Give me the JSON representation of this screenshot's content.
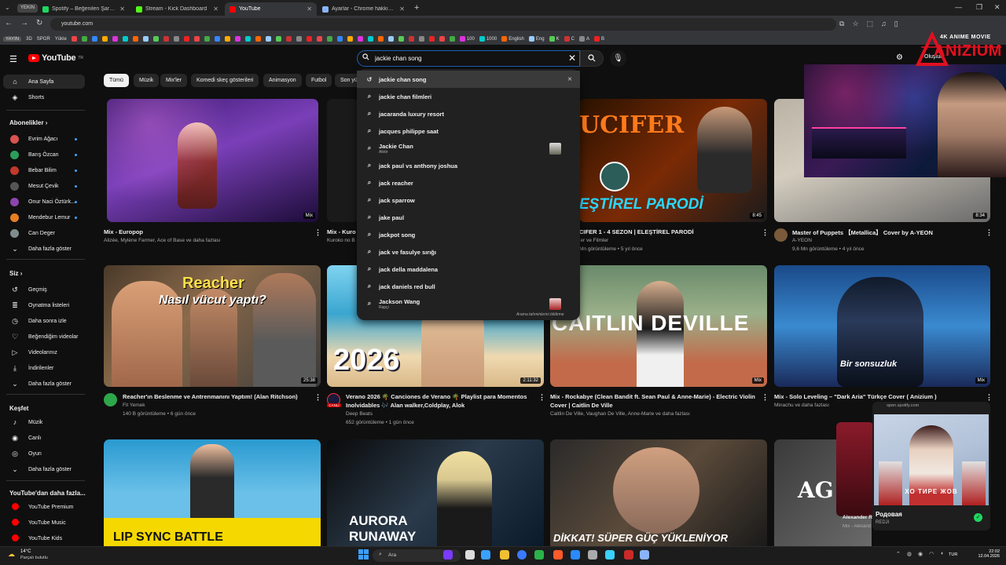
{
  "browser": {
    "profile_badge": "YEKIN",
    "tabs": [
      {
        "title": "Spotify – Beğenilen Şarkılar",
        "favicon_color": "#1ed760",
        "active": false
      },
      {
        "title": "Stream - Kick Dashboard",
        "favicon_color": "#53fc18",
        "active": false
      },
      {
        "title": "YouTube",
        "favicon_color": "#ff0000",
        "active": true
      },
      {
        "title": "Ayarlar - Chrome hakkında",
        "favicon_color": "#8ab4f8",
        "active": false
      }
    ],
    "url": "youtube.com",
    "bookmarks": [
      {
        "label": "YAYIN",
        "boxed": true
      },
      {
        "label": "3D",
        "boxed": false
      },
      {
        "label": "SPOR",
        "boxed": false
      },
      {
        "label": "Yükle",
        "boxed": false
      },
      {
        "label": "100",
        "boxed": false
      },
      {
        "label": "1000",
        "boxed": false
      },
      {
        "label": "English",
        "boxed": false
      },
      {
        "label": "Eng",
        "boxed": false
      },
      {
        "label": "K",
        "boxed": false
      },
      {
        "label": "C",
        "boxed": false
      },
      {
        "label": "A",
        "boxed": false
      },
      {
        "label": "B",
        "boxed": false
      }
    ]
  },
  "brand_overlay": {
    "small": "4K ANIME MOVIE",
    "big": "ANIZIUM"
  },
  "header": {
    "logo_text": "YouTube",
    "logo_region": "TR",
    "search_value": "jackie chan song",
    "create_label": "Oluştur"
  },
  "chips": [
    "Tümü",
    "Müzik",
    "Mix'ler",
    "Komedi skeç gösterileri",
    "Animasyon",
    "Futbol",
    "Son yü"
  ],
  "sidebar": {
    "main": [
      {
        "label": "Ana Sayfa",
        "icon": "home-icon",
        "glyph": "⌂"
      },
      {
        "label": "Shorts",
        "icon": "shorts-icon",
        "glyph": "◈"
      }
    ],
    "subs_title": "Abonelikler",
    "subscriptions": [
      {
        "label": "Evrim Ağacı",
        "color": "#d9534f"
      },
      {
        "label": "Barış Özcan",
        "color": "#2a9d5c"
      },
      {
        "label": "Bebar Bilim",
        "color": "#c0392b"
      },
      {
        "label": "Mesut Çevik",
        "color": "#555555"
      },
      {
        "label": "Onur Naci Öztürk...",
        "color": "#8e44ad"
      },
      {
        "label": "Mendebur Lemur",
        "color": "#e67e22"
      },
      {
        "label": "Can Deger",
        "color": "#7f8c8d"
      }
    ],
    "subs_more": "Daha fazla göster",
    "you_title": "Siz",
    "you": [
      {
        "label": "Geçmiş",
        "icon": "history-icon",
        "glyph": "↺"
      },
      {
        "label": "Oynatma listeleri",
        "icon": "playlists-icon",
        "glyph": "≣"
      },
      {
        "label": "Daha sonra izle",
        "icon": "watch-later-icon",
        "glyph": "◷"
      },
      {
        "label": "Beğendiğim videolar",
        "icon": "like-icon",
        "glyph": "♡"
      },
      {
        "label": "Videolarınız",
        "icon": "your-videos-icon",
        "glyph": "▷"
      },
      {
        "label": "İndirilenler",
        "icon": "download-icon",
        "glyph": "⤓"
      },
      {
        "label": "Daha fazla göster",
        "icon": "chevron-down-icon",
        "glyph": "⌄"
      }
    ],
    "explore_title": "Keşfet",
    "explore": [
      {
        "label": "Müzik",
        "icon": "music-icon",
        "glyph": "♪"
      },
      {
        "label": "Canlı",
        "icon": "live-icon",
        "glyph": "◉"
      },
      {
        "label": "Oyun",
        "icon": "gaming-icon",
        "glyph": "◎"
      },
      {
        "label": "Daha fazla göster",
        "icon": "chevron-down-icon",
        "glyph": "⌄"
      }
    ],
    "more_title": "YouTube'dan daha fazla...",
    "more": [
      {
        "label": "YouTube Premium"
      },
      {
        "label": "YouTube Music"
      },
      {
        "label": "YouTube Kids"
      }
    ]
  },
  "suggestions": [
    {
      "text": "jackie chan song",
      "type": "history"
    },
    {
      "text": "jackie chan filmleri",
      "type": "search"
    },
    {
      "text": "jacaranda luxury resort",
      "type": "search"
    },
    {
      "text": "jacques philippe saat",
      "type": "search"
    },
    {
      "text": "Jackie Chan",
      "sub": "Aktör",
      "type": "entity"
    },
    {
      "text": "jack paul vs anthony joshua",
      "type": "search"
    },
    {
      "text": "jack reacher",
      "type": "search"
    },
    {
      "text": "jack sparrow",
      "type": "search"
    },
    {
      "text": "jake paul",
      "type": "search"
    },
    {
      "text": "jackpot song",
      "type": "search"
    },
    {
      "text": "jack ve fasulye sırığı",
      "type": "search"
    },
    {
      "text": "jack della maddalena",
      "type": "search"
    },
    {
      "text": "jack daniels red bull",
      "type": "search"
    },
    {
      "text": "Jackson Wang",
      "sub": "Rapçi",
      "type": "entity"
    }
  ],
  "suggest_footer": "Arama tahminlerini bildirme",
  "videos": {
    "row1": [
      {
        "title": "Mix - Europop",
        "meta1": "Alizée, Mylène Farmer, Ace of Base ve daha fazlası",
        "meta2": "",
        "badge": "Mix"
      },
      {
        "title": "Mix - Kuro",
        "meta1": "Kuroko no B",
        "meta2": "",
        "badge": ""
      },
      {
        "title": "CIFER 1 - 4 SEZON | ELEŞTİREL PARODİ",
        "meta1": "ler ve Filmler",
        "meta2": "Mn görüntüleme • 5 yıl önce",
        "badge": "8:45",
        "overlay": "EŞTİREL PARODİ",
        "overlay_top": "UCIFER"
      },
      {
        "title": "Master of Puppets 【Metallica】 Cover by A-YEON",
        "meta1": "A-YEON",
        "meta2": "9,6 Mn görüntüleme • 4 yıl önce",
        "badge": "8:34"
      }
    ],
    "row2": [
      {
        "title": "Reacher'ın Beslenme ve Antrenmanını Yaptım! (Alan Ritchson)",
        "meta1": "Fit Yemek",
        "meta2": "140 B görüntüleme • 6 gün önce",
        "badge": "25:38",
        "overlay1": "Reacher",
        "overlay2": "Nasıl vücut yaptı?"
      },
      {
        "title": "Verano 2026 🌴 Canciones de Verano 🌴 Playlist para Momentos",
        "title2": "Inolvidables 🎶 Alan walker,Coldplay, Alok",
        "meta1": "Deep Beats",
        "meta2": "652 görüntüleme • 1 gün önce",
        "badge": "2:11:32",
        "overlay": "2026",
        "live_label": "CANLI"
      },
      {
        "title": "Mix - Rockabye (Clean Bandit ft. Sean Paul & Anne-Marie) - Electric Violin",
        "title2": "Cover | Caitlin De Ville",
        "meta1": "Caitlin De Ville, Vaughan De Ville, Anne-Marie ve daha fazlası",
        "meta2": "",
        "badge": "Mix",
        "overlay": "CAITLIN DEVILLE"
      },
      {
        "title": "Mix - Solo Leveling – \"Dark Aria\" Türkçe Cover ( Anizium )",
        "meta1": "Minachu ve daha fazlası",
        "meta2": "",
        "badge": "Mix",
        "overlay": "Bir sonsuzluk"
      }
    ],
    "row3": [
      {
        "overlay": "LIP SYNC BATTLE"
      },
      {
        "overlay1": "AURORA",
        "overlay2": "RUNAWAY"
      },
      {
        "overlay": "DİKKAT! SÜPER GÜÇ YÜKLENİYOR"
      },
      {
        "overlay": "AG",
        "author": "Alexander R",
        "meta": "Mix - Alexand"
      }
    ]
  },
  "spotify_popup": {
    "url": "open.spotify.com",
    "song": "Родовая",
    "artist": "REDJI",
    "art_text": "ХО ТИРЕ ЖОВ"
  },
  "taskbar": {
    "weather_temp": "14°C",
    "weather_desc": "Parçalı bulutlu",
    "search_placeholder": "Ara",
    "time": "22:02",
    "date": "12.04.2026",
    "lang": "TUR"
  }
}
